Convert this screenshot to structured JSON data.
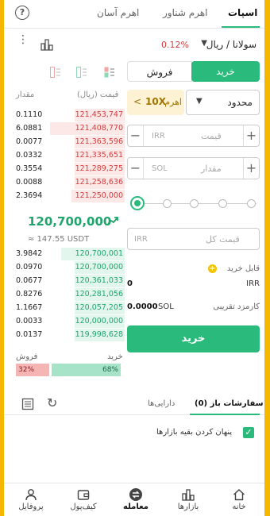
{
  "header": {
    "tabs": [
      {
        "label": "اسپات"
      },
      {
        "label": "اهرم شناور"
      },
      {
        "label": "اهرم آسان"
      }
    ]
  },
  "pair": {
    "name": "سولانا / ریال",
    "change": "0.12%"
  },
  "trade": {
    "buy_label": "خرید",
    "sell_label": "فروش",
    "order_type": "محدود",
    "leverage_label": "اهرم",
    "leverage_value": "10X",
    "price_placeholder": "قیمت",
    "price_unit": "IRR",
    "amount_placeholder": "مقدار",
    "amount_unit": "SOL",
    "total_placeholder": "قیمت کل",
    "total_unit": "IRR",
    "slider_percent": 0,
    "buyable_label": "قابل خرید",
    "buyable_value": "0",
    "buyable_unit": "IRR",
    "fee_label": "کارمزد تقریبی",
    "fee_value": "0.0000",
    "fee_unit": "SOL",
    "submit_label": "خرید"
  },
  "orderbook": {
    "price_header": "قیمت (ریال)",
    "amount_header": "مقدار",
    "asks": [
      {
        "price": "121,453,747",
        "amount": "0.1110",
        "depth": 0.45
      },
      {
        "price": "121,408,770",
        "amount": "6.0881",
        "depth": 0.67
      },
      {
        "price": "121,363,596",
        "amount": "0.0077",
        "depth": 0.45
      },
      {
        "price": "121,335,651",
        "amount": "0.0332",
        "depth": 0.45
      },
      {
        "price": "121,289,275",
        "amount": "0.3554",
        "depth": 0.45
      },
      {
        "price": "121,258,636",
        "amount": "0.0088",
        "depth": 0.45
      },
      {
        "price": "121,250,000",
        "amount": "2.3694",
        "depth": 0.48
      }
    ],
    "last_price": "120,700,000",
    "last_usdt": "≈ 147.55 USDT",
    "bids": [
      {
        "price": "120,700,001",
        "amount": "3.9842",
        "depth": 0.57
      },
      {
        "price": "120,700,000",
        "amount": "0.0970",
        "depth": 0.45
      },
      {
        "price": "120,361,033",
        "amount": "0.0677",
        "depth": 0.45
      },
      {
        "price": "120,281,056",
        "amount": "0.8276",
        "depth": 0.45
      },
      {
        "price": "120,057,205",
        "amount": "1.1667",
        "depth": 0.45
      },
      {
        "price": "120,000,000",
        "amount": "0.0033",
        "depth": 0.45
      },
      {
        "price": "119,998,628",
        "amount": "0.0137",
        "depth": 0.45
      }
    ],
    "buy_label": "خرید",
    "sell_label": "فروش",
    "buy_ratio": "68%",
    "sell_ratio": "32%"
  },
  "orders": {
    "tab_open": "سفارشات باز (0)",
    "tab_assets": "دارایی‌ها",
    "hide_others": "پنهان کردن بقیه بازارها"
  },
  "nav": [
    {
      "label": "خانه",
      "icon": "home-icon"
    },
    {
      "label": "بازارها",
      "icon": "markets-icon"
    },
    {
      "label": "معامله",
      "icon": "trade-icon"
    },
    {
      "label": "کیف‌پول",
      "icon": "wallet-icon"
    },
    {
      "label": "پروفایل",
      "icon": "profile-icon"
    }
  ],
  "colors": {
    "accent": "#2aba7c",
    "sell": "#d43b3b",
    "frame": "#f5b800"
  }
}
